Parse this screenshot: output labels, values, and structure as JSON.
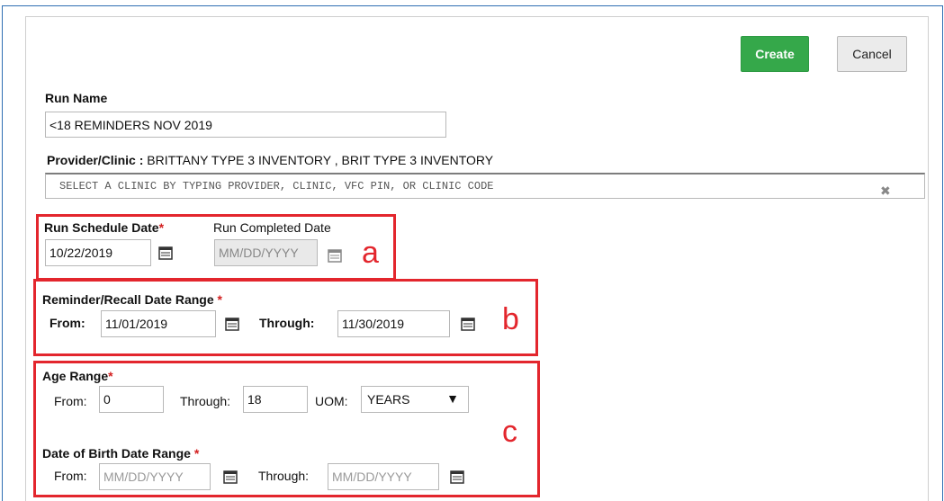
{
  "actions": {
    "create_label": "Create",
    "cancel_label": "Cancel"
  },
  "run_name": {
    "label": "Run Name",
    "value": "<18 REMINDERS NOV 2019"
  },
  "provider": {
    "label": "Provider/Clinic :",
    "value": "BRITTANY TYPE 3 INVENTORY , BRIT TYPE 3 INVENTORY",
    "placeholder": "SELECT A CLINIC BY TYPING PROVIDER, CLINIC, VFC PIN, OR CLINIC CODE",
    "clear_glyph": "✖"
  },
  "schedule": {
    "run_schedule_label": "Run Schedule Date",
    "run_schedule_value": "10/22/2019",
    "run_completed_label": "Run Completed Date",
    "run_completed_placeholder": "MM/DD/YYYY"
  },
  "reminder_range": {
    "label": "Reminder/Recall Date Range",
    "from_label": "From:",
    "from_value": "11/01/2019",
    "through_label": "Through:",
    "through_value": "11/30/2019"
  },
  "age_range": {
    "label": "Age Range",
    "from_label": "From:",
    "from_value": "0",
    "through_label": "Through:",
    "through_value": "18",
    "uom_label": "UOM:",
    "uom_value": "YEARS",
    "uom_arrow": "▼"
  },
  "dob_range": {
    "label": "Date of Birth Date Range",
    "from_label": "From:",
    "from_placeholder": "MM/DD/YYYY",
    "through_label": "Through:",
    "through_placeholder": "MM/DD/YYYY"
  },
  "required_marker": "*",
  "annotations": {
    "a": "a",
    "b": "b",
    "c": "c"
  },
  "colors": {
    "create_green": "#35a84a",
    "annotation_red": "#e3262d",
    "required_red": "#d32020"
  }
}
